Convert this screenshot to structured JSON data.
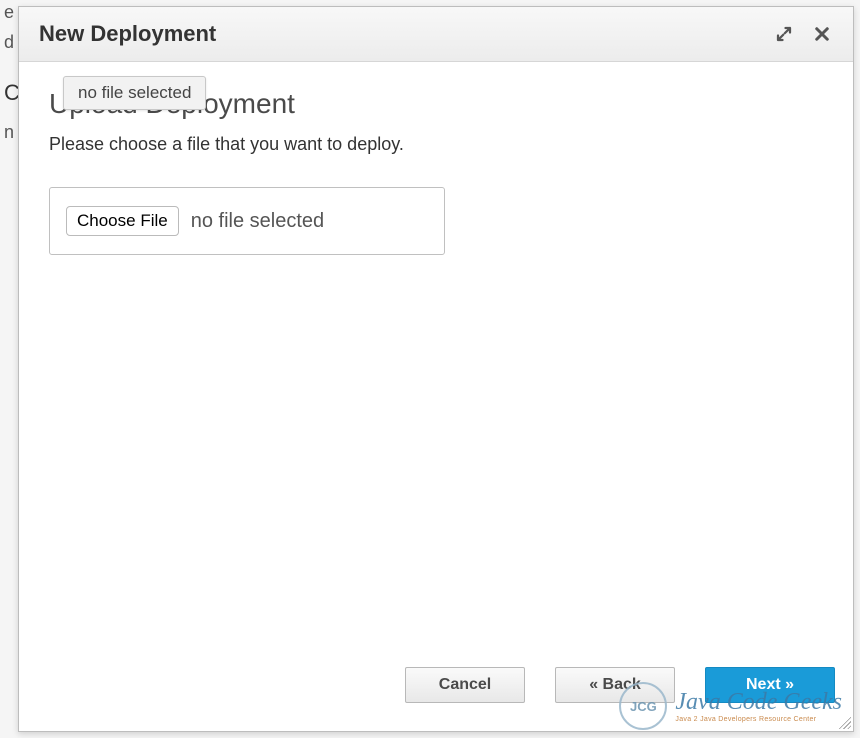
{
  "background": {
    "chars1": "e",
    "chars2": "d",
    "chars3": "C",
    "chars4": "n"
  },
  "modal": {
    "title": "New Deployment",
    "tooltip": "no file selected",
    "body": {
      "title": "Upload Deployment",
      "description": "Please choose a file that you want to deploy.",
      "choose_file_label": "Choose File",
      "file_status": "no file selected"
    },
    "footer": {
      "cancel_label": "Cancel",
      "back_label": "« Back",
      "next_label": "Next »"
    }
  },
  "watermark": {
    "circle": "JCG",
    "main": "Java Code Geeks",
    "sub": "Java 2 Java Developers Resource Center"
  }
}
